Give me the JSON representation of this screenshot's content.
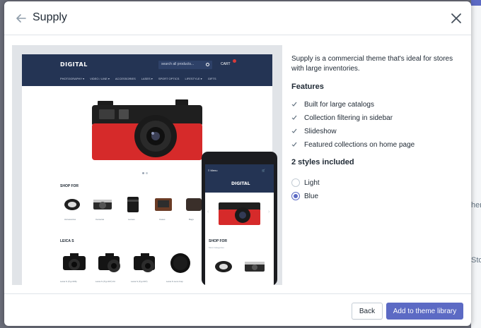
{
  "background": {
    "fragments": [
      "her",
      "Sto"
    ]
  },
  "modal": {
    "title": "Supply",
    "back_icon": "arrow-left-icon",
    "close_icon": "close-icon"
  },
  "preview": {
    "desktop": {
      "logo": "DIGITAL",
      "search_placeholder": "search all products...",
      "cart_label": "CART",
      "nav": [
        "PHOTOGRAPHY ▾",
        "VIDEO / LINE ▾",
        "ACCESSORIES",
        "LASES ▾",
        "SPORT OPTICS",
        "LIFESTYLE ▾",
        "GIFTS"
      ],
      "shop_for": "SHOP FOR",
      "shop_items": [
        "Accessories",
        "Cameras",
        "Lenses",
        "Cases",
        "Bags"
      ],
      "leica_title": "LEICA S",
      "leica_items": [
        "Leica S (Typ 006)",
        "Leica S (Typ 007) Kit",
        "Leica S (Typ 007)",
        "Leica S Lens Cap"
      ]
    },
    "mobile": {
      "menu": "≡ Menu",
      "cart": "🛒",
      "logo": "DIGITAL",
      "shop_for": "SHOP FOR",
      "caption": "Most Categories"
    }
  },
  "details": {
    "description": "Supply is a commercial theme that's ideal for stores with large inventories.",
    "features_title": "Features",
    "features": [
      "Built for large catalogs",
      "Collection filtering in sidebar",
      "Slideshow",
      "Featured collections on home page"
    ],
    "styles_title": "2 styles included",
    "styles": [
      {
        "label": "Light",
        "selected": false
      },
      {
        "label": "Blue",
        "selected": true
      }
    ]
  },
  "footer": {
    "back_label": "Back",
    "add_label": "Add to theme library"
  },
  "colors": {
    "accent": "#5c6ac4",
    "header_navy": "#243454",
    "check_grey": "#637381"
  }
}
